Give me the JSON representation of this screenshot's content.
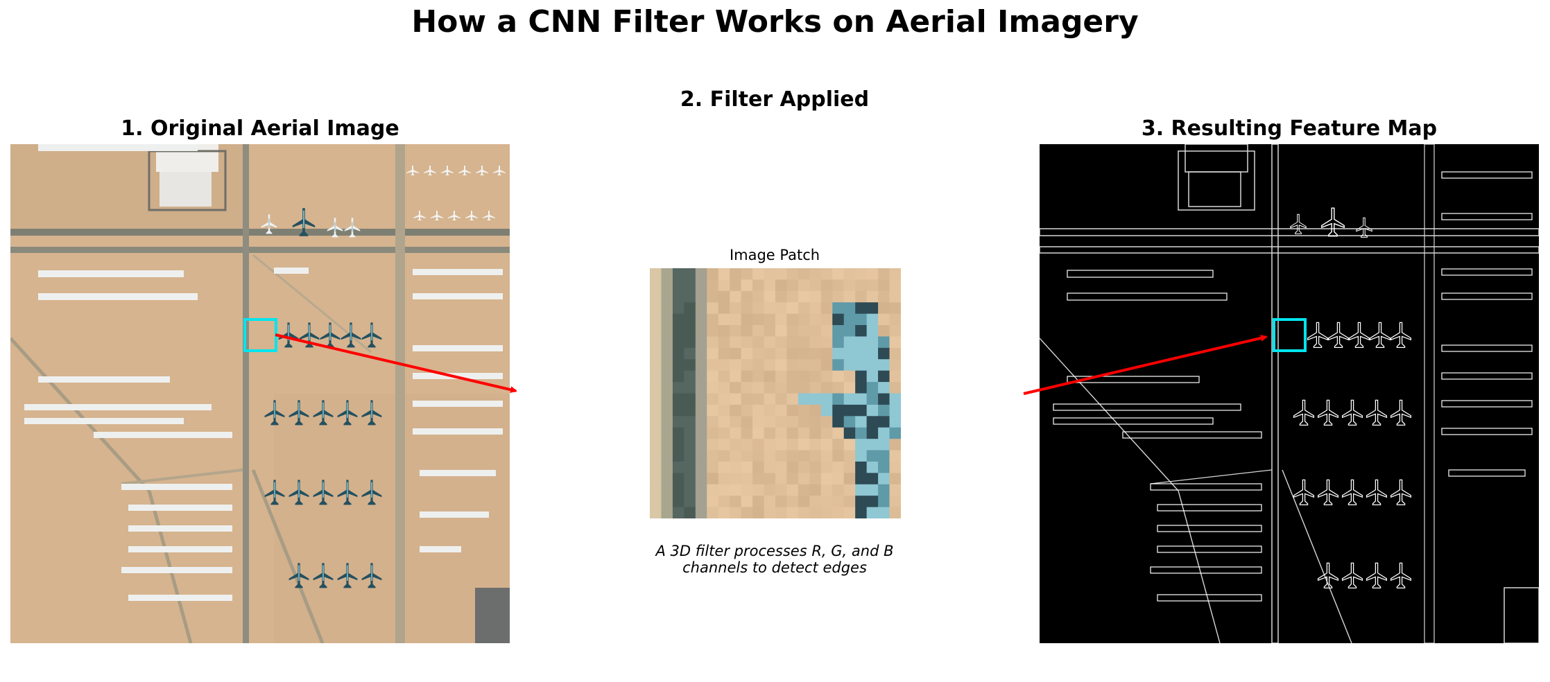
{
  "figure": {
    "title": "How a CNN Filter Works on Aerial Imagery"
  },
  "panels": {
    "original": {
      "title": "1. Original Aerial Image"
    },
    "filter": {
      "title": "2. Filter Applied",
      "patch_title": "Image Patch",
      "caption_line1": "A 3D filter processes R, G, and B",
      "caption_line2": "channels to detect edges"
    },
    "feature_map": {
      "title": "3. Resulting Feature Map"
    }
  },
  "colors": {
    "highlight": "#00e5ee",
    "arrow": "#ff0000",
    "terrain": "#d2b48c",
    "road": "#8c8c7a",
    "aircraft_dark": "#2f5d6e",
    "aircraft_light": "#e8eef0",
    "edges": "#ffffff"
  },
  "icons": {
    "arrow_left": "red-arrow-icon",
    "arrow_right": "red-arrow-icon"
  }
}
